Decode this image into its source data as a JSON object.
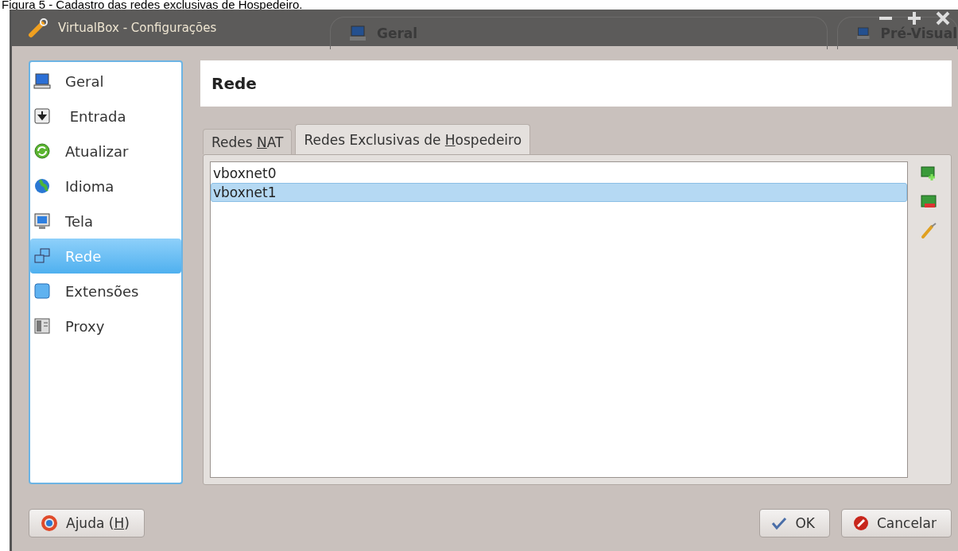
{
  "caption": "Figura 5 - Cadastro das redes exclusivas de Hospedeiro.",
  "window": {
    "title": "VirtualBox - Configurações",
    "background_tabs": [
      "Geral",
      "Pré-Visual"
    ]
  },
  "sidebar": {
    "items": [
      {
        "label": "Geral",
        "selected": false
      },
      {
        "label": " Entrada",
        "selected": false
      },
      {
        "label": "Atualizar",
        "selected": false
      },
      {
        "label": "Idioma",
        "selected": false
      },
      {
        "label": "Tela",
        "selected": false
      },
      {
        "label": "Rede",
        "selected": true
      },
      {
        "label": "Extensões",
        "selected": false
      },
      {
        "label": "Proxy",
        "selected": false
      }
    ]
  },
  "header": "Rede",
  "tabs": [
    {
      "before": "Redes ",
      "mnemonic": "N",
      "after": "AT",
      "selected": false
    },
    {
      "before": "Redes Exclusivas de ",
      "mnemonic": "H",
      "after": "ospedeiro",
      "selected": true
    }
  ],
  "networks": [
    {
      "name": "vboxnet0",
      "selected": false
    },
    {
      "name": "vboxnet1",
      "selected": true
    }
  ],
  "buttons": [
    {
      "kind": "help",
      "before": "Ajuda (",
      "mnemonic": "H",
      "after": ")"
    },
    {
      "kind": "ok",
      "before": "OK"
    },
    {
      "kind": "cancel",
      "before": "Cancelar"
    }
  ]
}
